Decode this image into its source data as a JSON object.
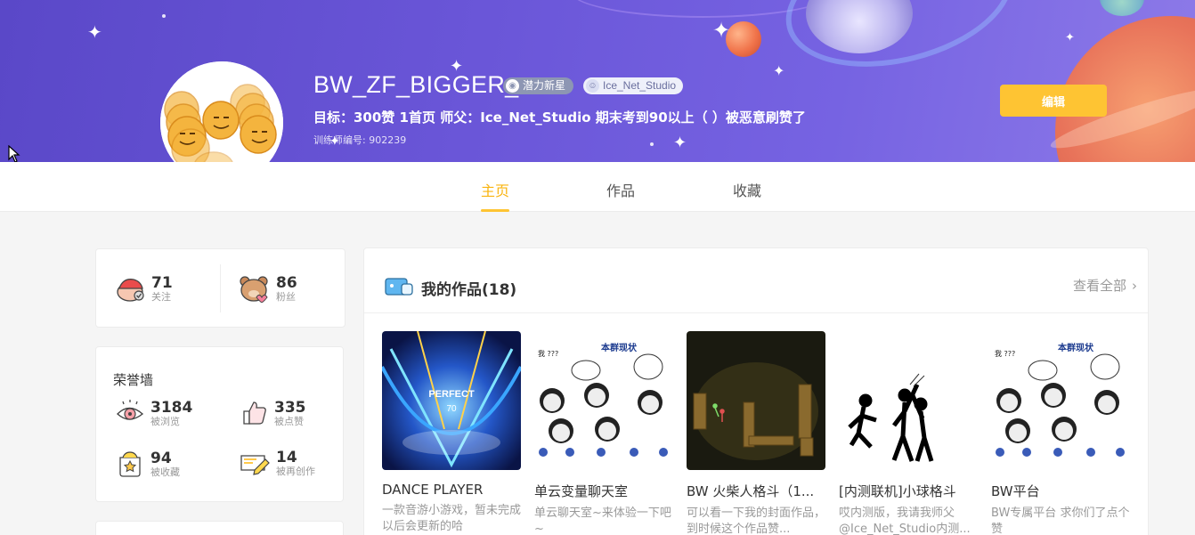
{
  "profile": {
    "username": "BW_ZF_BIGGER_",
    "badge_newstar": "潜力新星",
    "badge_studio": "Ice_Net_Studio",
    "motto": "目标：300赞 1首页 师父：Ice_Net_Studio 期末考到90以上（ ）被恶意刷赞了",
    "trainer_id": "训练师编号: 902239",
    "edit_label": "编辑"
  },
  "tabs": [
    {
      "label": "主页",
      "active": true
    },
    {
      "label": "作品",
      "active": false
    },
    {
      "label": "收藏",
      "active": false
    }
  ],
  "follow": {
    "following_count": "71",
    "following_label": "关注",
    "fans_count": "86",
    "fans_label": "粉丝"
  },
  "honor": {
    "title": "荣誉墙",
    "views": {
      "count": "3184",
      "label": "被浏览"
    },
    "likes": {
      "count": "335",
      "label": "被点赞"
    },
    "favorites": {
      "count": "94",
      "label": "被收藏"
    },
    "remixes": {
      "count": "14",
      "label": "被再创作"
    }
  },
  "works": {
    "title": "我的作品(18)",
    "view_all": "查看全部",
    "items": [
      {
        "title": "DANCE PLAYER",
        "desc": "一款音游小游戏，暂未完成 以后会更新的哈"
      },
      {
        "title": "单云变量聊天室",
        "desc": "单云聊天室~来体验一下吧~"
      },
      {
        "title": "BW 火柴人格斗（1...",
        "desc": "可以看一下我的封面作品，到时候这个作品赞..."
      },
      {
        "title": "[内测联机]小球格斗",
        "desc": "哎内测版，我请我师父@Ice_Net_Studio内测..."
      },
      {
        "title": "BW平台",
        "desc": "BW专属平台 求你们了点个赞"
      }
    ]
  },
  "thumb_texts": {
    "perfect": "PERFECT",
    "score": "70",
    "meme_title": "本群现状",
    "meme_q": "我 ???"
  },
  "colors": {
    "accent": "#fec433",
    "tab_active": "#f9b40f",
    "banner": "#6a56d8"
  }
}
